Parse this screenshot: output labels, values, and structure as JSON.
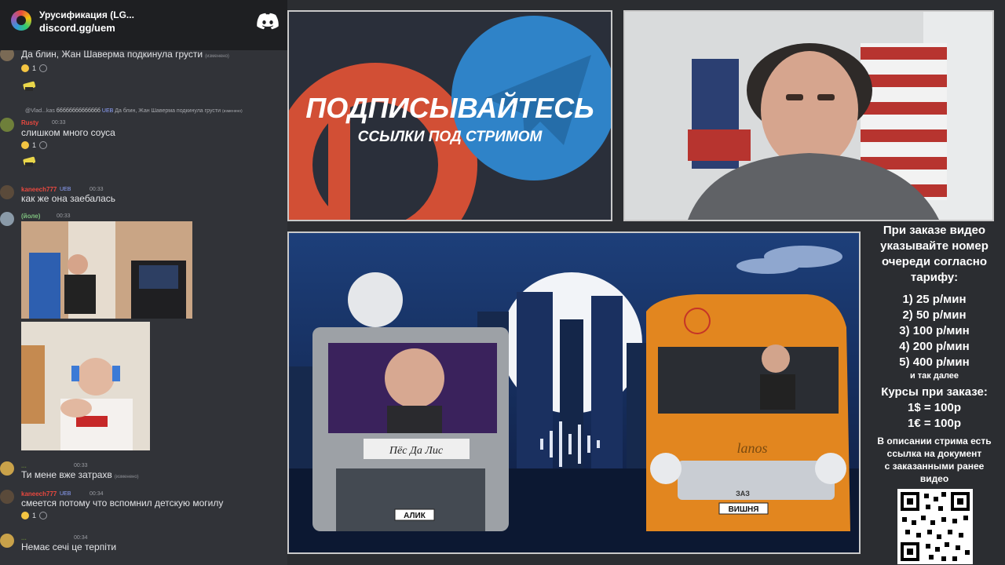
{
  "server": {
    "name": "Урусификация (LG...",
    "invite": "discord.gg/uem"
  },
  "messages": [
    {
      "text": "Да блин, Жан Шаверма подкинула грусти",
      "edited": "(изменено)",
      "reaction_count": "1"
    },
    {
      "reply_user": "@Vlad...kas",
      "reply_text": "бббббббббббббб",
      "reply_badge": "UEB",
      "reply_quote": "Да блин, Жан Шаверма подкинула грусти",
      "reply_edited": "(изменено)",
      "user": "Rusty",
      "time": "00:33",
      "text": "слишком много соуса",
      "reaction_count": "1"
    },
    {
      "user": "kaneech777",
      "badge": "UEB",
      "time": "00:33",
      "text": "как же она заебалась"
    },
    {
      "user": "(йоле)",
      "time": "00:33"
    },
    {
      "user": "...",
      "time": "00:33",
      "text": "Ти мене вже затрахв",
      "edited": "(изменено)"
    },
    {
      "user": "kaneech777",
      "badge": "UEB",
      "time": "00:34",
      "text": "смеется потому что вспомнил детскую могилу",
      "reaction_count": "1"
    },
    {
      "user": "...",
      "time": "00:34",
      "text": "Немає сечі це терпіти"
    }
  ],
  "promo": {
    "headline": "ПОДПИСЫВАЙТЕСЬ",
    "subline": "ССЫЛКИ ПОД СТРИМОМ"
  },
  "game": {
    "left_sign": "Пёс Да Лис",
    "left_plate": "АЛИК",
    "right_brand": "lanos",
    "right_plate": "ВИШНЯ",
    "right_logo": "ЗАЗ"
  },
  "info": {
    "intro": [
      "При заказе видео",
      "указывайте номер",
      "очереди согласно",
      "тарифу:"
    ],
    "tariffs": [
      "1) 25 р/мин",
      "2) 50 р/мин",
      "3) 100 р/мин",
      "4) 200 р/мин",
      "5) 400 р/мин"
    ],
    "etc": "и так далее",
    "rates_title": "Курсы при заказе:",
    "rates": [
      "1$ = 100р",
      "1€ = 100р"
    ],
    "desc": [
      "В описании стрима есть",
      "ссылка на документ",
      "с заказанными ранее",
      "видео"
    ]
  },
  "colors": {
    "discord_bg": "#313338",
    "header_bg": "#1e1f22",
    "red_user": "#e8483f",
    "badge": "#8fa3ff"
  }
}
